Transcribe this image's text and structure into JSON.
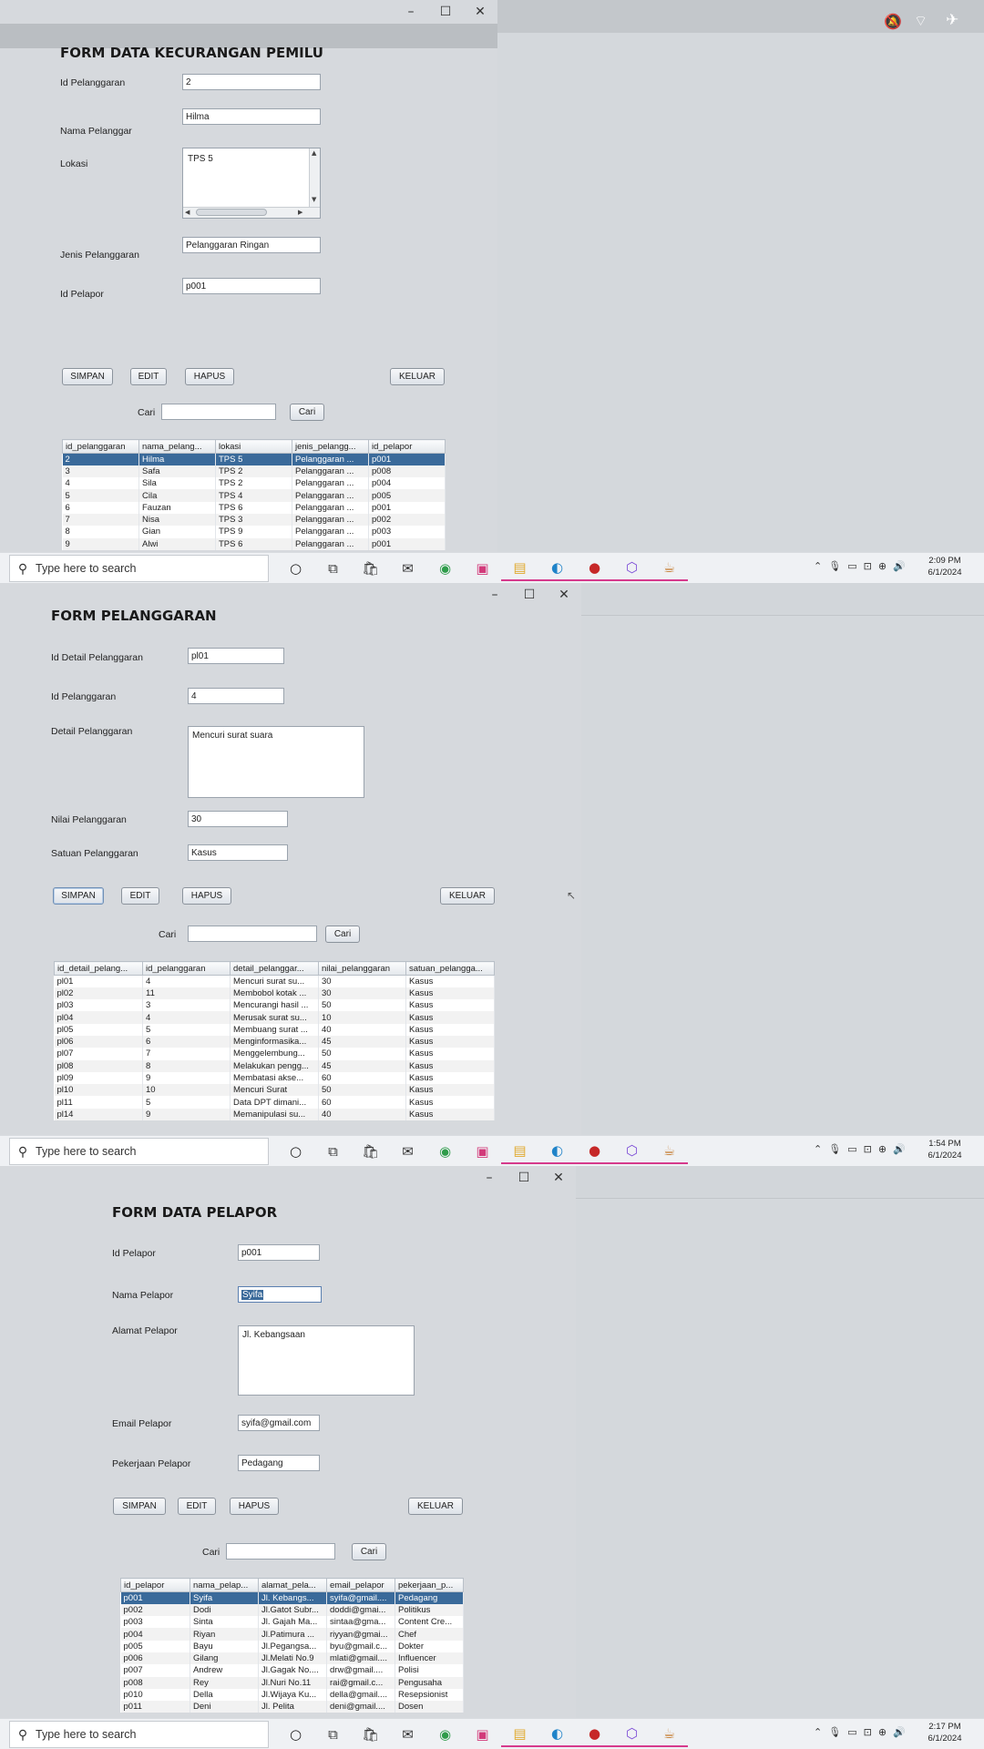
{
  "status_icons": {
    "top": [
      "mute-icon",
      "wifi-icon",
      "airplane-icon"
    ]
  },
  "form1": {
    "title": "FORM DATA KECURANGAN PEMILU",
    "labels": {
      "id": "Id Pelanggaran",
      "nama": "Nama Pelanggar",
      "lokasi": "Lokasi",
      "jenis": "Jenis Pelanggaran",
      "pelapor": "Id Pelapor"
    },
    "values": {
      "id": "2",
      "nama": "Hilma",
      "lokasi": "TPS 5",
      "jenis": "Pelanggaran Ringan",
      "pelapor": "p001"
    },
    "buttons": {
      "simpan": "SIMPAN",
      "edit": "EDIT",
      "hapus": "HAPUS",
      "keluar": "KELUAR",
      "cari": "Cari"
    },
    "search_label": "Cari",
    "search_value": "",
    "columns": [
      "id_pelanggaran",
      "nama_pelang...",
      "lokasi",
      "jenis_pelangg...",
      "id_pelapor"
    ],
    "rows": [
      [
        "2",
        "Hilma",
        "TPS 5",
        "Pelanggaran ...",
        "p001"
      ],
      [
        "3",
        "Safa",
        "TPS 2",
        "Pelanggaran ...",
        "p008"
      ],
      [
        "4",
        "Sila",
        "TPS 2",
        "Pelanggaran ...",
        "p004"
      ],
      [
        "5",
        "Cila",
        "TPS 4",
        "Pelanggaran ...",
        "p005"
      ],
      [
        "6",
        "Fauzan",
        "TPS 6",
        "Pelanggaran ...",
        "p001"
      ],
      [
        "7",
        "Nisa",
        "TPS 3",
        "Pelanggaran ...",
        "p002"
      ],
      [
        "8",
        "Gian",
        "TPS 9",
        "Pelanggaran ...",
        "p003"
      ],
      [
        "9",
        "Alwi",
        "TPS 6",
        "Pelanggaran ...",
        "p001"
      ]
    ],
    "selected_row": 0
  },
  "form2": {
    "title": "FORM PELANGGARAN",
    "labels": {
      "id_detail": "Id Detail Pelanggaran",
      "id_pel": "Id Pelanggaran",
      "detail": "Detail Pelanggaran",
      "nilai": "Nilai Pelanggaran",
      "satuan": "Satuan Pelanggaran"
    },
    "values": {
      "id_detail": "pl01",
      "id_pel": "4",
      "detail": "Mencuri surat suara",
      "nilai": "30",
      "satuan": "Kasus"
    },
    "buttons": {
      "simpan": "SIMPAN",
      "edit": "EDIT",
      "hapus": "HAPUS",
      "keluar": "KELUAR",
      "cari": "Cari"
    },
    "search_label": "Cari",
    "search_value": "",
    "columns": [
      "id_detail_pelang...",
      "id_pelanggaran",
      "detail_pelanggar...",
      "nilai_pelanggaran",
      "satuan_pelangga..."
    ],
    "rows": [
      [
        "pl01",
        "4",
        "Mencuri surat su...",
        "30",
        "Kasus"
      ],
      [
        "pl02",
        "11",
        "Membobol kotak ...",
        "30",
        "Kasus"
      ],
      [
        "pl03",
        "3",
        "Mencurangi hasil ...",
        "50",
        "Kasus"
      ],
      [
        "pl04",
        "4",
        "Merusak surat su...",
        "10",
        "Kasus"
      ],
      [
        "pl05",
        "5",
        "Membuang surat ...",
        "40",
        "Kasus"
      ],
      [
        "pl06",
        "6",
        "Menginformasika...",
        "45",
        "Kasus"
      ],
      [
        "pl07",
        "7",
        "Menggelembung...",
        "50",
        "Kasus"
      ],
      [
        "pl08",
        "8",
        "Melakukan pengg...",
        "45",
        "Kasus"
      ],
      [
        "pl09",
        "9",
        "Membatasi akse...",
        "60",
        "Kasus"
      ],
      [
        "pl10",
        "10",
        "Mencuri Surat",
        "50",
        "Kasus"
      ],
      [
        "pl11",
        "5",
        "Data DPT dimani...",
        "60",
        "Kasus"
      ],
      [
        "pl14",
        "9",
        "Memanipulasi su...",
        "40",
        "Kasus"
      ]
    ]
  },
  "form3": {
    "title": "FORM DATA PELAPOR",
    "labels": {
      "id": "Id Pelapor",
      "nama": "Nama Pelapor",
      "alamat": "Alamat Pelapor",
      "email": "Email Pelapor",
      "pekerjaan": "Pekerjaan Pelapor"
    },
    "values": {
      "id": "p001",
      "nama": "Syifa",
      "alamat": "Jl. Kebangsaan",
      "email": "syifa@gmail.com",
      "pekerjaan": "Pedagang"
    },
    "buttons": {
      "simpan": "SIMPAN",
      "edit": "EDIT",
      "hapus": "HAPUS",
      "keluar": "KELUAR",
      "cari": "Cari"
    },
    "search_label": "Cari",
    "search_value": "",
    "columns": [
      "id_pelapor",
      "nama_pelap...",
      "alamat_pela...",
      "email_pelapor",
      "pekerjaan_p..."
    ],
    "rows": [
      [
        "p001",
        "Syifa",
        "Jl. Kebangs...",
        "syifa@gmail....",
        "Pedagang"
      ],
      [
        "p002",
        "Dodi",
        "Jl.Gatot Subr...",
        "doddi@gmai...",
        "Politikus"
      ],
      [
        "p003",
        "Sinta",
        "Jl. Gajah Ma...",
        "sintaa@gma...",
        "Content Cre..."
      ],
      [
        "p004",
        "Riyan",
        "Jl.Patimura ...",
        "riyyan@gmai...",
        "Chef"
      ],
      [
        "p005",
        "Bayu",
        "Jl.Pegangsa...",
        "byu@gmail.c...",
        "Dokter"
      ],
      [
        "p006",
        "Gilang",
        "Jl.Melati No.9",
        "mlati@gmail....",
        "Influencer"
      ],
      [
        "p007",
        "Andrew",
        "Jl.Gagak No....",
        "drw@gmail....",
        "Polisi"
      ],
      [
        "p008",
        "Rey",
        "Jl.Nuri No.11",
        "rai@gmail.c...",
        "Pengusaha"
      ],
      [
        "p010",
        "Della",
        "Jl.Wijaya Ku...",
        "della@gmail....",
        "Resepsionist"
      ],
      [
        "p011",
        "Deni",
        "Jl. Pelita",
        "deni@gmail....",
        "Dosen"
      ]
    ],
    "selected_row": 0
  },
  "taskbars": [
    {
      "search_placeholder": "Type here to search",
      "time": "2:09 PM",
      "date": "6/1/2024"
    },
    {
      "search_placeholder": "Type here to search",
      "time": "1:54 PM",
      "date": "6/1/2024"
    },
    {
      "search_placeholder": "Type here to search",
      "time": "2:17 PM",
      "date": "6/1/2024"
    }
  ],
  "taskbar_icons": [
    "cortana-icon",
    "task-view-icon",
    "store-icon",
    "mail-icon",
    "chrome-icon",
    "figma-icon",
    "file-explorer-icon",
    "edge-icon",
    "app-icon",
    "office-icon",
    "java-icon"
  ],
  "tray_icons": [
    "chevron-up-icon",
    "mic-icon",
    "battery-icon",
    "display-icon",
    "network-icon",
    "volume-icon"
  ]
}
